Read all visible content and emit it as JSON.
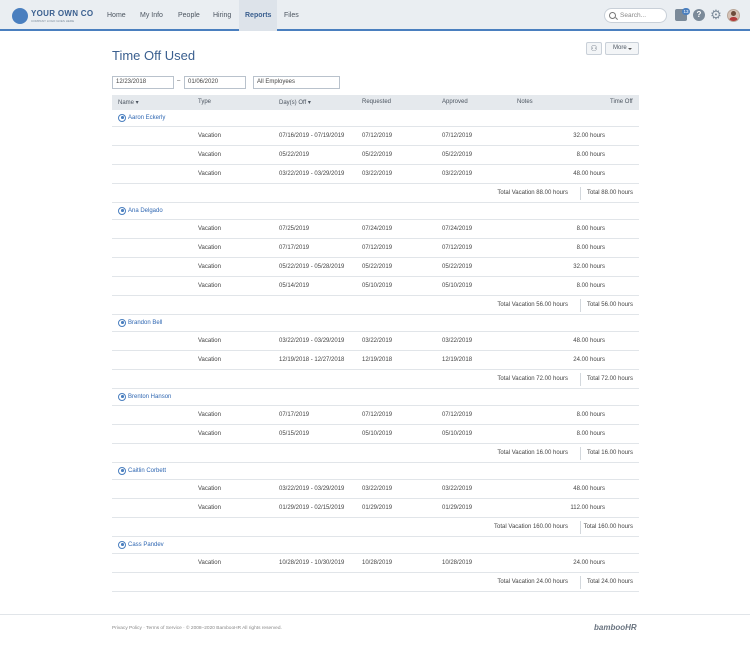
{
  "header": {
    "logo": {
      "name": "YOUR OWN CO",
      "tagline": "COMPANY LOGO GOES HERE"
    },
    "nav": [
      "Home",
      "My Info",
      "People",
      "Hiring",
      "Reports",
      "Files"
    ],
    "active_nav": "Reports",
    "search_placeholder": "Search...",
    "inbox_badge": "13"
  },
  "page": {
    "title": "Time Off Used",
    "more_label": "More",
    "start_date": "12/23/2018",
    "end_date": "01/06/2020",
    "date_separator": "–",
    "filter": "All Employees"
  },
  "columns": {
    "name": "Name",
    "type": "Type",
    "days_off": "Day(s) Off",
    "requested": "Requested",
    "approved": "Approved",
    "notes": "Notes",
    "time_off": "Time Off"
  },
  "groups": [
    {
      "name": "Aaron Eckerly",
      "rows": [
        {
          "type": "Vacation",
          "days": "07/16/2019 - 07/19/2019",
          "requested": "07/12/2019",
          "approved": "07/12/2019",
          "hours": "32.00 hours"
        },
        {
          "type": "Vacation",
          "days": "05/22/2019",
          "requested": "05/22/2019",
          "approved": "05/22/2019",
          "hours": "8.00 hours"
        },
        {
          "type": "Vacation",
          "days": "03/22/2019 - 03/29/2019",
          "requested": "03/22/2019",
          "approved": "03/22/2019",
          "hours": "48.00 hours"
        }
      ],
      "total_label": "Total Vacation 88.00 hours",
      "grand_total": "Total 88.00 hours"
    },
    {
      "name": "Ana Delgado",
      "rows": [
        {
          "type": "Vacation",
          "days": "07/25/2019",
          "requested": "07/24/2019",
          "approved": "07/24/2019",
          "hours": "8.00 hours"
        },
        {
          "type": "Vacation",
          "days": "07/17/2019",
          "requested": "07/12/2019",
          "approved": "07/12/2019",
          "hours": "8.00 hours"
        },
        {
          "type": "Vacation",
          "days": "05/22/2019 - 05/28/2019",
          "requested": "05/22/2019",
          "approved": "05/22/2019",
          "hours": "32.00 hours"
        },
        {
          "type": "Vacation",
          "days": "05/14/2019",
          "requested": "05/10/2019",
          "approved": "05/10/2019",
          "hours": "8.00 hours"
        }
      ],
      "total_label": "Total Vacation 56.00 hours",
      "grand_total": "Total 56.00 hours"
    },
    {
      "name": "Brandon Bell",
      "rows": [
        {
          "type": "Vacation",
          "days": "03/22/2019 - 03/29/2019",
          "requested": "03/22/2019",
          "approved": "03/22/2019",
          "hours": "48.00 hours"
        },
        {
          "type": "Vacation",
          "days": "12/19/2018 - 12/27/2018",
          "requested": "12/19/2018",
          "approved": "12/19/2018",
          "hours": "24.00 hours"
        }
      ],
      "total_label": "Total Vacation 72.00 hours",
      "grand_total": "Total 72.00 hours"
    },
    {
      "name": "Brenton Hanson",
      "rows": [
        {
          "type": "Vacation",
          "days": "07/17/2019",
          "requested": "07/12/2019",
          "approved": "07/12/2019",
          "hours": "8.00 hours"
        },
        {
          "type": "Vacation",
          "days": "05/15/2019",
          "requested": "05/10/2019",
          "approved": "05/10/2019",
          "hours": "8.00 hours"
        }
      ],
      "total_label": "Total Vacation 16.00 hours",
      "grand_total": "Total 16.00 hours"
    },
    {
      "name": "Caitlin Corbett",
      "rows": [
        {
          "type": "Vacation",
          "days": "03/22/2019 - 03/29/2019",
          "requested": "03/22/2019",
          "approved": "03/22/2019",
          "hours": "48.00 hours"
        },
        {
          "type": "Vacation",
          "days": "01/29/2019 - 02/15/2019",
          "requested": "01/29/2019",
          "approved": "01/29/2019",
          "hours": "112.00 hours"
        }
      ],
      "total_label": "Total Vacation 160.00 hours",
      "grand_total": "Total 160.00 hours"
    },
    {
      "name": "Cass Pandev",
      "rows": [
        {
          "type": "Vacation",
          "days": "10/28/2019 - 10/30/2019",
          "requested": "10/28/2019",
          "approved": "10/28/2019",
          "hours": "24.00 hours"
        }
      ],
      "total_label": "Total Vacation 24.00 hours",
      "grand_total": "Total 24.00 hours"
    }
  ],
  "footer": {
    "privacy": "Privacy Policy",
    "terms": "Terms of Service",
    "copyright": "© 2008–2020 BambooHR All rights reserved.",
    "brand": "bambooHR"
  }
}
